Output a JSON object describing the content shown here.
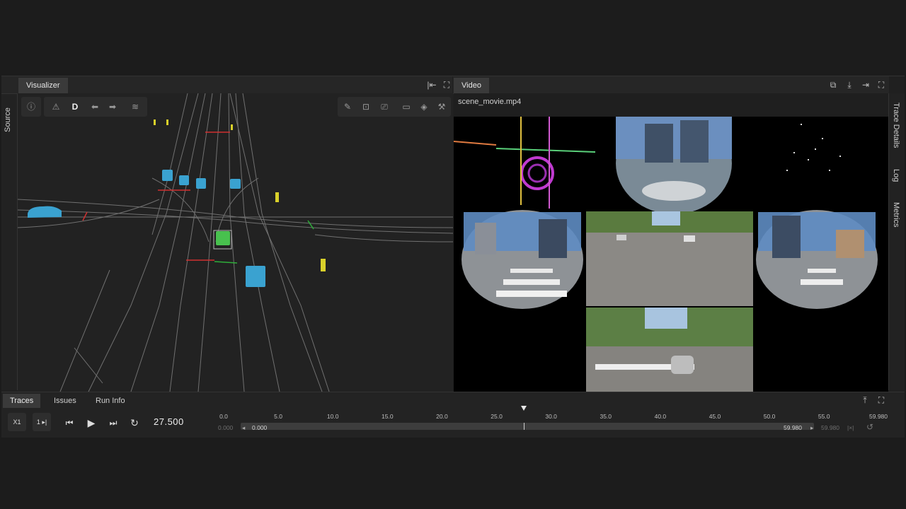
{
  "left_sidebar": {
    "label": "Source"
  },
  "visualizer": {
    "tab_label": "Visualizer",
    "toolbar": {
      "d_label": "D"
    }
  },
  "video": {
    "tab_label": "Video",
    "filename": "scene_movie.mp4"
  },
  "right_sidebar": {
    "items": [
      "Trace Details",
      "Log",
      "Metrics"
    ]
  },
  "bottom": {
    "tabs": [
      "Traces",
      "Issues",
      "Run Info"
    ],
    "speed_label": "X1",
    "step_label": "1 ▸|",
    "current_time": "27.500",
    "ticks": [
      "0.0",
      "5.0",
      "10.0",
      "15.0",
      "20.0",
      "25.0",
      "30.0",
      "35.0",
      "40.0",
      "45.0",
      "50.0",
      "55.0",
      "59.980"
    ],
    "range_start_outer": "0.000",
    "range_start": "0.000",
    "range_end": "59.980",
    "range_end_outer": "59.980",
    "playhead_value": 27.5,
    "duration": 59.98
  }
}
